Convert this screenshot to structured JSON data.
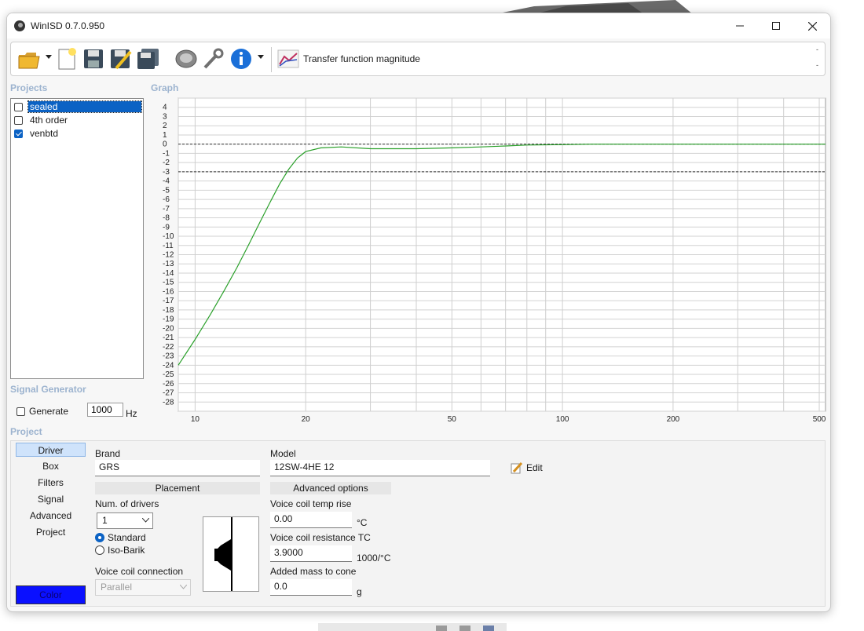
{
  "window": {
    "title": "WinISD 0.7.0.950"
  },
  "toolbar": {
    "graph_type": "Transfer function magnitude",
    "right_top": "-",
    "right_bottom": "-"
  },
  "sections": {
    "projects": "Projects",
    "graph": "Graph",
    "signal_generator": "Signal Generator",
    "project": "Project"
  },
  "projects": [
    {
      "name": "sealed",
      "checked": false,
      "selected": true
    },
    {
      "name": "4th order",
      "checked": false,
      "selected": false
    },
    {
      "name": "venbtd",
      "checked": true,
      "selected": false
    }
  ],
  "signal_generator": {
    "generate_label": "Generate",
    "frequency": "1000",
    "unit": "Hz"
  },
  "project_tabs": [
    "Driver",
    "Box",
    "Filters",
    "Signal",
    "Advanced",
    "Project"
  ],
  "color_button": {
    "label": "Color",
    "color": "#0a10ff"
  },
  "driver": {
    "brand_label": "Brand",
    "brand_value": "GRS",
    "model_label": "Model",
    "model_value": "12SW-4HE 12",
    "edit_label": "Edit",
    "placement_header": "Placement",
    "num_drivers_label": "Num. of drivers",
    "num_drivers_value": "1",
    "radio_standard": "Standard",
    "radio_isobarik": "Iso-Barik",
    "voice_coil_connection_label": "Voice coil connection",
    "voice_coil_connection_value": "Parallel",
    "advanced_header": "Advanced options",
    "vc_temp_label": "Voice coil temp rise",
    "vc_temp_value": "0.00",
    "vc_temp_unit": "°C",
    "vc_res_label": "Voice coil resistance TC",
    "vc_res_value": "3.9000",
    "vc_res_unit": "1000/°C",
    "added_mass_label": "Added mass to cone",
    "added_mass_value": "0.0",
    "added_mass_unit": "g"
  },
  "chart_data": {
    "type": "line",
    "x_scale": "log",
    "xlim": [
      9,
      520
    ],
    "ylim": [
      -29,
      5
    ],
    "x_ticks": [
      10,
      20,
      50,
      100,
      200,
      500
    ],
    "y_ticks": [
      4,
      3,
      2,
      1,
      0,
      -1,
      -2,
      -3,
      -4,
      -5,
      -6,
      -7,
      -8,
      -9,
      -10,
      -11,
      -12,
      -13,
      -14,
      -15,
      -16,
      -17,
      -18,
      -19,
      -20,
      -21,
      -22,
      -23,
      -24,
      -25,
      -26,
      -27,
      -28
    ],
    "reference_lines": [
      0,
      -3
    ],
    "grid": true,
    "series": [
      {
        "color": "#2aa02a",
        "x": [
          9,
          10,
          11,
          12,
          13,
          14,
          15,
          16,
          17,
          18,
          19,
          20,
          22,
          25,
          30,
          40,
          50,
          60,
          70,
          80,
          100,
          120,
          140,
          200,
          300,
          400,
          520
        ],
        "y": [
          -24.0,
          -21.2,
          -18.5,
          -15.9,
          -13.4,
          -10.9,
          -8.5,
          -6.3,
          -4.3,
          -2.7,
          -1.5,
          -0.8,
          -0.4,
          -0.3,
          -0.5,
          -0.5,
          -0.4,
          -0.3,
          -0.2,
          -0.1,
          -0.05,
          0,
          0,
          0,
          0,
          0,
          0
        ]
      }
    ]
  }
}
